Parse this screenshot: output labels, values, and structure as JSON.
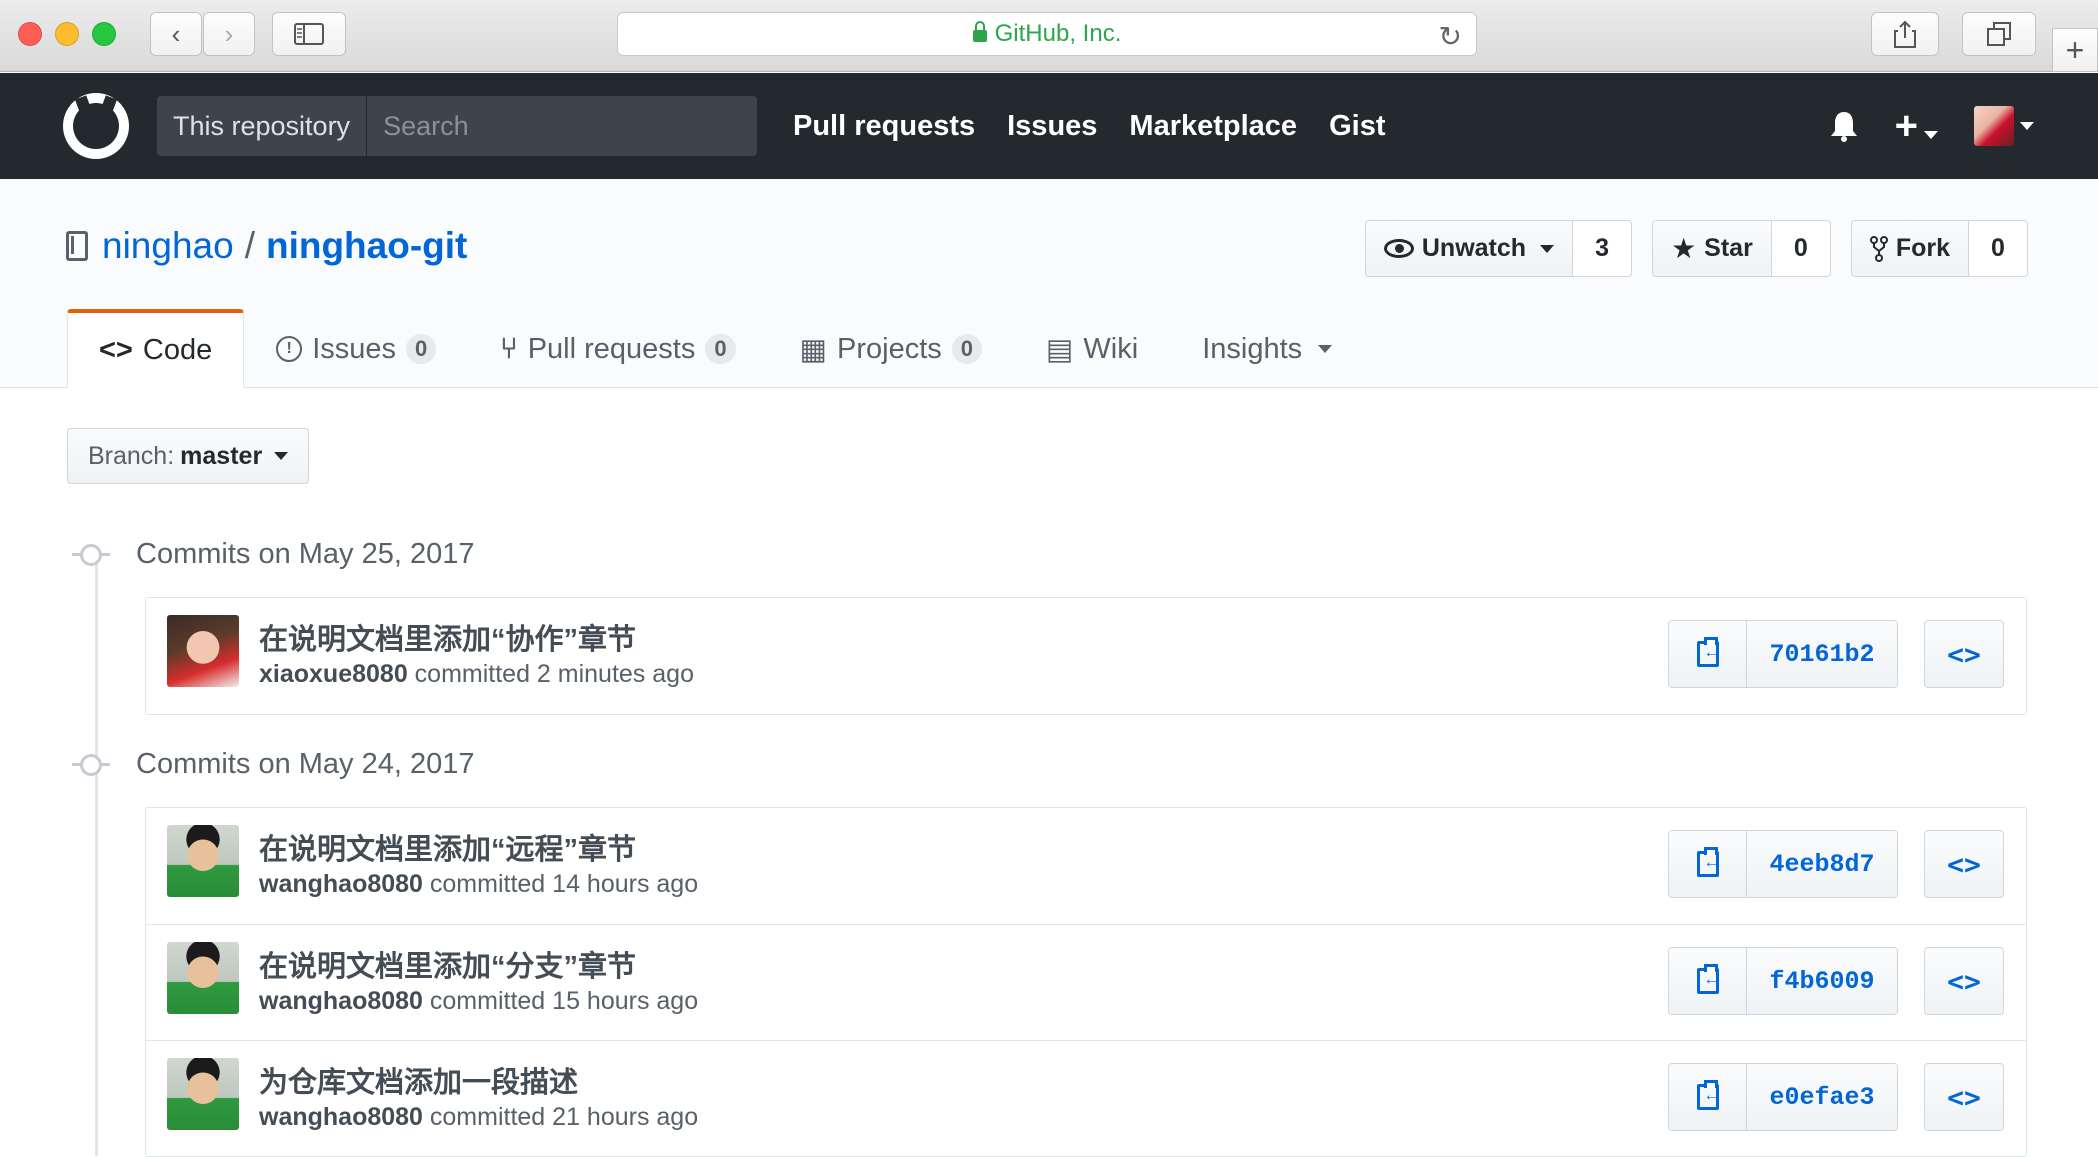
{
  "browser": {
    "address": "GitHub, Inc.",
    "back_icon": "‹",
    "forward_icon": "›"
  },
  "header": {
    "search_scope": "This repository",
    "search_placeholder": "Search",
    "nav": [
      "Pull requests",
      "Issues",
      "Marketplace",
      "Gist"
    ],
    "plus_label": "+"
  },
  "repo": {
    "owner": "ninghao",
    "separator": "/",
    "name": "ninghao-git",
    "watch": {
      "label": "Unwatch",
      "count": "3"
    },
    "star": {
      "label": "Star",
      "count": "0"
    },
    "fork": {
      "label": "Fork",
      "count": "0"
    }
  },
  "tabs": [
    {
      "label": "Code",
      "icon": "<>"
    },
    {
      "label": "Issues",
      "counter": "0",
      "icon": "!"
    },
    {
      "label": "Pull requests",
      "counter": "0",
      "icon": "⑂"
    },
    {
      "label": "Projects",
      "counter": "0",
      "icon": "▦"
    },
    {
      "label": "Wiki",
      "icon": "▤"
    },
    {
      "label": "Insights",
      "icon": ""
    }
  ],
  "branch": {
    "prefix": "Branch:",
    "name": "master"
  },
  "groups": [
    {
      "heading": "Commits on May 25, 2017",
      "commits": [
        {
          "title": "在说明文档里添加“协作”章节",
          "author": "xiaoxue8080",
          "meta": "committed 2 minutes ago",
          "sha": "70161b2"
        }
      ]
    },
    {
      "heading": "Commits on May 24, 2017",
      "commits": [
        {
          "title": "在说明文档里添加“远程”章节",
          "author": "wanghao8080",
          "meta": "committed 14 hours ago",
          "sha": "4eeb8d7"
        },
        {
          "title": "在说明文档里添加“分支”章节",
          "author": "wanghao8080",
          "meta": "committed 15 hours ago",
          "sha": "f4b6009"
        },
        {
          "title": "为仓库文档添加一段描述",
          "author": "wanghao8080",
          "meta": "committed 21 hours ago",
          "sha": "e0efae3"
        }
      ]
    }
  ],
  "browse_label": "<>"
}
